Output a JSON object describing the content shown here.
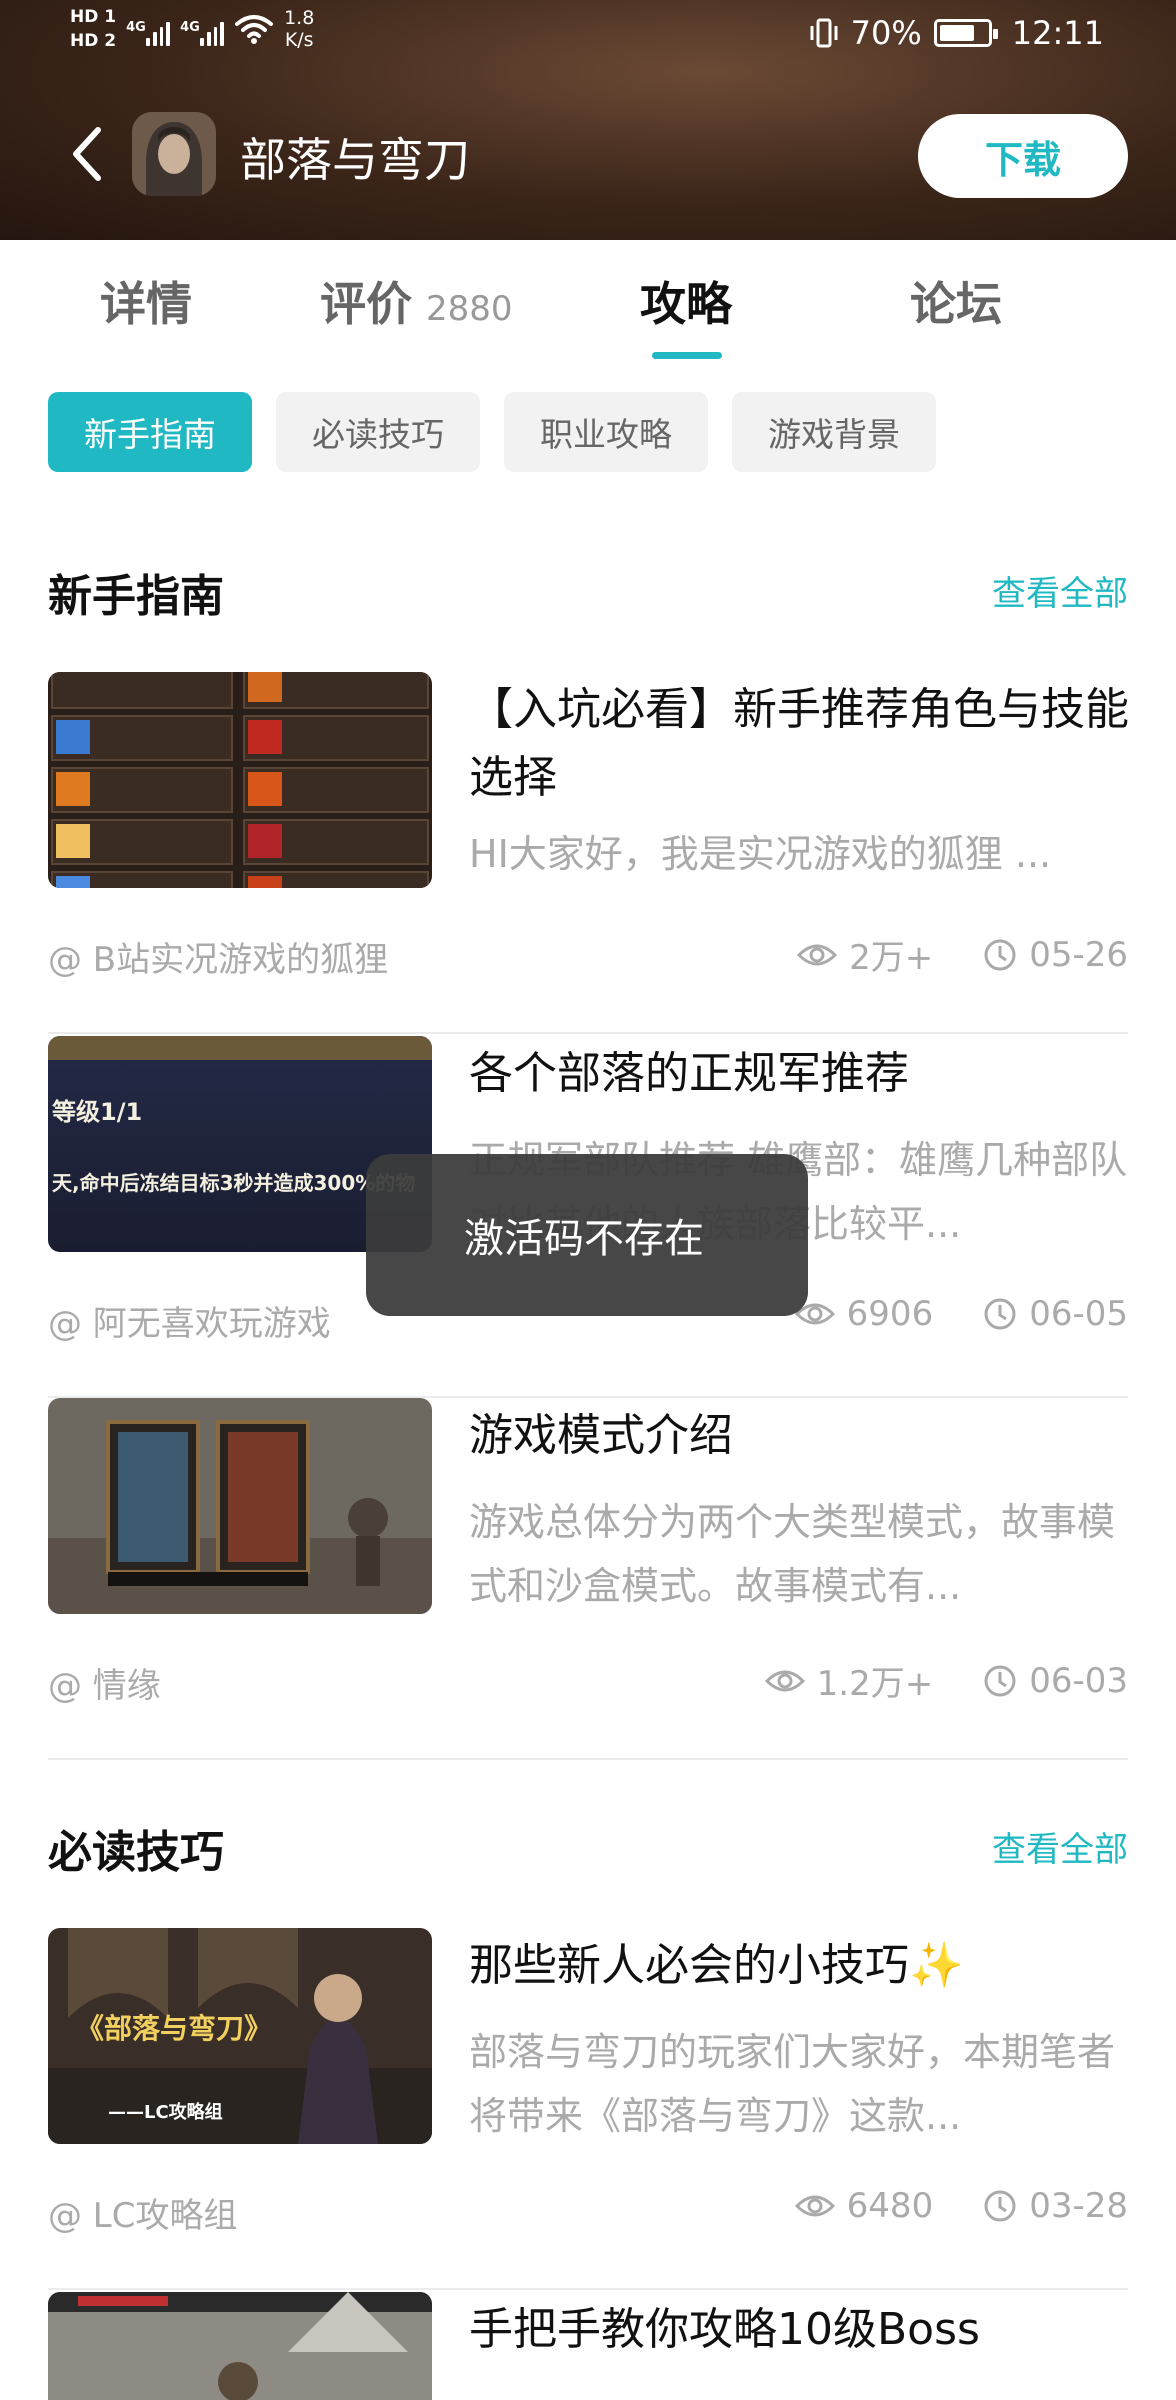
{
  "status_bar": {
    "hd1": "HD 1",
    "hd2": "HD 2",
    "net1": "4G",
    "net2": "4G",
    "speed_value": "1.8",
    "speed_unit": "K/s",
    "battery_percent": "70%",
    "time": "12:11"
  },
  "header": {
    "app_name": "部落与弯刀",
    "download_label": "下载"
  },
  "tabs": [
    {
      "label": "详情",
      "count": ""
    },
    {
      "label": "评价",
      "count": "2880"
    },
    {
      "label": "攻略",
      "count": ""
    },
    {
      "label": "论坛",
      "count": ""
    }
  ],
  "active_tab": "攻略",
  "chips": [
    "新手指南",
    "必读技巧",
    "职业攻略",
    "游戏背景"
  ],
  "active_chip": "新手指南",
  "sections": [
    {
      "title": "新手指南",
      "see_all": "查看全部",
      "articles": [
        {
          "title": "【入坑必看】新手推荐角色与技能选择",
          "desc": "HI大家好，我是实况游戏的狐狸 ...",
          "author": "@ B站实况游戏的狐狸",
          "views": "2万+",
          "date": "05-26",
          "thumb_caption": ""
        },
        {
          "title": "各个部落的正规军推荐",
          "desc": "正规军部队推荐 雄鹰部：雄鹰几种部队对比其他的人族部落比较平...",
          "author": "@ 阿无喜欢玩游戏",
          "views": "6906",
          "date": "06-05",
          "thumb_caption": "等级1/1",
          "thumb_caption2": "天,命中后冻结目标3秒并造成300%的物"
        },
        {
          "title": "游戏模式介绍",
          "desc": "游戏总体分为两个大类型模式，故事模式和沙盒模式。故事模式有...",
          "author": "@ 情缘",
          "views": "1.2万+",
          "date": "06-03",
          "thumb_caption": ""
        }
      ]
    },
    {
      "title": "必读技巧",
      "see_all": "查看全部",
      "articles": [
        {
          "title": "那些新人必会的小技巧✨",
          "desc": "部落与弯刀的玩家们大家好，本期笔者将带来《部落与弯刀》这款...",
          "author": "@ LC攻略组",
          "views": "6480",
          "date": "03-28",
          "thumb_caption": "《部落与弯刀》",
          "thumb_caption2": "——LC攻略组"
        },
        {
          "title": "手把手教你攻略10级Boss",
          "desc": "",
          "author": "",
          "views": "",
          "date": "",
          "thumb_caption": ""
        }
      ]
    }
  ],
  "toast": "激活码不存在",
  "colors": {
    "accent": "#20b8c2",
    "header_dark": "#2d1c13",
    "muted_text": "#aaaaaa"
  },
  "icons": {
    "back": "chevron-left-icon",
    "views": "eye-icon",
    "date": "clock-icon"
  }
}
